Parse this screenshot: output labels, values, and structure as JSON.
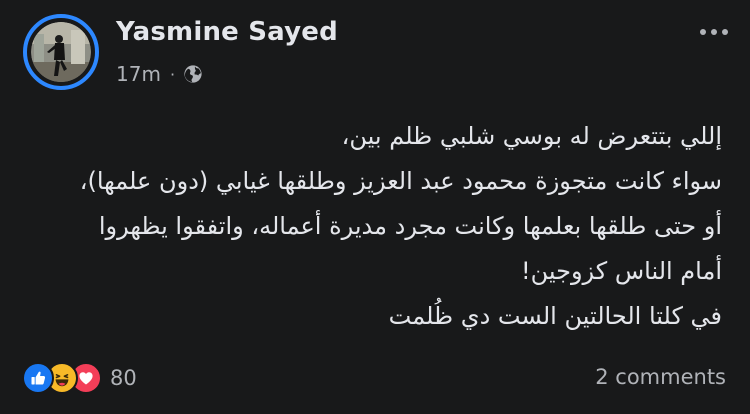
{
  "post": {
    "author_name": "Yasmine Sayed",
    "timestamp": "17m",
    "separator": "·",
    "audience_icon": "globe-icon",
    "more_icon": "more-options-icon",
    "text_lines": [
      "إللي بتتعرض له بوسي شلبي ظلم بين،",
      "سواء كانت متجوزة محمود عبد العزيز وطلقها غيابي (دون علمها)،",
      "أو حتى طلقها بعلمها وكانت مجرد مديرة أعماله، واتفقوا يظهروا",
      "أمام الناس كزوجين!",
      "في كلتا الحالتين الست دي ظُلمت"
    ]
  },
  "footer": {
    "reaction_icons": [
      "like-icon",
      "haha-icon",
      "love-icon"
    ],
    "reaction_count": "80",
    "comments_label": "2 comments"
  },
  "colors": {
    "background": "#18191a",
    "primary_text": "#e4e6eb",
    "secondary_text": "#b0b3b8",
    "story_ring": "#2d88ff",
    "like_blue": "#1877f2",
    "haha_yellow": "#f7b928",
    "love_red": "#f33e58"
  }
}
